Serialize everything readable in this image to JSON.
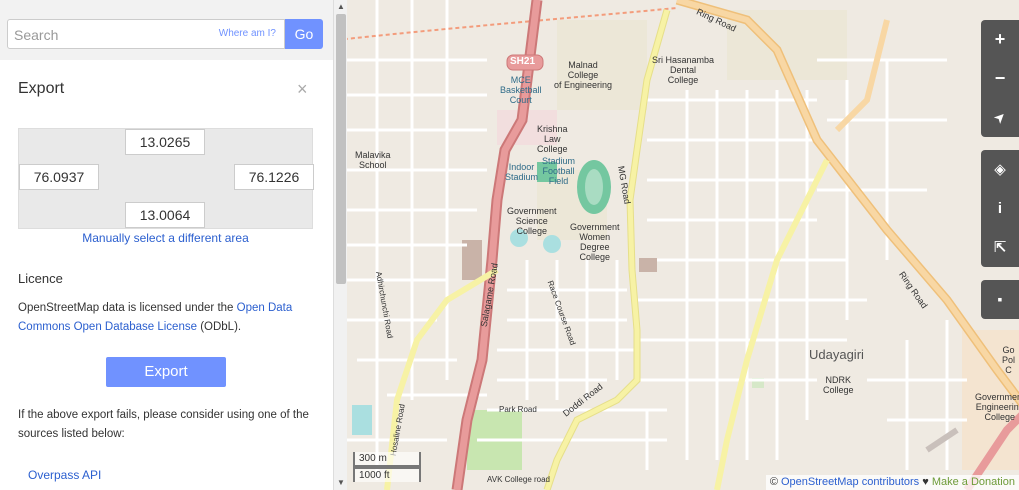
{
  "search": {
    "placeholder": "Search",
    "where_am_i": "Where am I?",
    "go_label": "Go"
  },
  "export_panel": {
    "title": "Export",
    "close_glyph": "×",
    "bbox": {
      "north": "13.0265",
      "west": "76.0937",
      "east": "76.1226",
      "south": "13.0064"
    },
    "manual_select": "Manually select a different area",
    "licence_title": "Licence",
    "licence_prefix": "OpenStreetMap data is licensed under the ",
    "licence_link": "Open Data Commons Open Database License",
    "licence_suffix": " (ODbL).",
    "export_button": "Export",
    "fail_text": "If the above export fails, please consider using one of the sources listed below:",
    "overpass": "Overpass API"
  },
  "scrollbar": {
    "up_glyph": "▲",
    "down_glyph": "▼"
  },
  "map": {
    "labels": {
      "sh21": "SH21",
      "mce_court": "MCE\nBasketball\nCourt",
      "malnad": "Malnad\nCollege\nof Engineering",
      "sri_hasanamba": "Sri Hasanamba\nDental\nCollege",
      "ring_road_top": "Ring Road",
      "malavika": "Malavika\nSchool",
      "krishna_law": "Krishna\nLaw\nCollege",
      "indoor_stadium": "Indoor\nStadium",
      "stadium_field": "Stadium\nFootball\nField",
      "mg_road": "MG Road",
      "govt_science": "Government\nScience\nCollege",
      "govt_women": "Government\nWomen\nDegree\nCollege",
      "salagame": "Salagame Road",
      "adhirchunchi": "Adhirchunchi Road",
      "race_course": "Race Course Road",
      "ring_road_right": "Ring Road",
      "udayagiri": "Udayagiri",
      "ndrk": "NDRK\nCollege",
      "govt_poly": "Go\nPol\nC",
      "govt_eng": "Government\nEngineering\nCollege",
      "doddi": "Doddi Road",
      "park_road": "Park Road",
      "hosaline": "Hosaline Road",
      "avk": "AVK College road"
    },
    "controls": {
      "zoom_in": "+",
      "zoom_out": "−",
      "locate": "➤",
      "layers": "◈",
      "info": "i",
      "share": "⇱",
      "note": "▪"
    },
    "scale": {
      "metric": "300 m",
      "imperial": "1000 ft"
    },
    "attribution": {
      "copyright": "© ",
      "osm": "OpenStreetMap contributors",
      "heart": " ♥ ",
      "donate": "Make a Donation"
    }
  }
}
